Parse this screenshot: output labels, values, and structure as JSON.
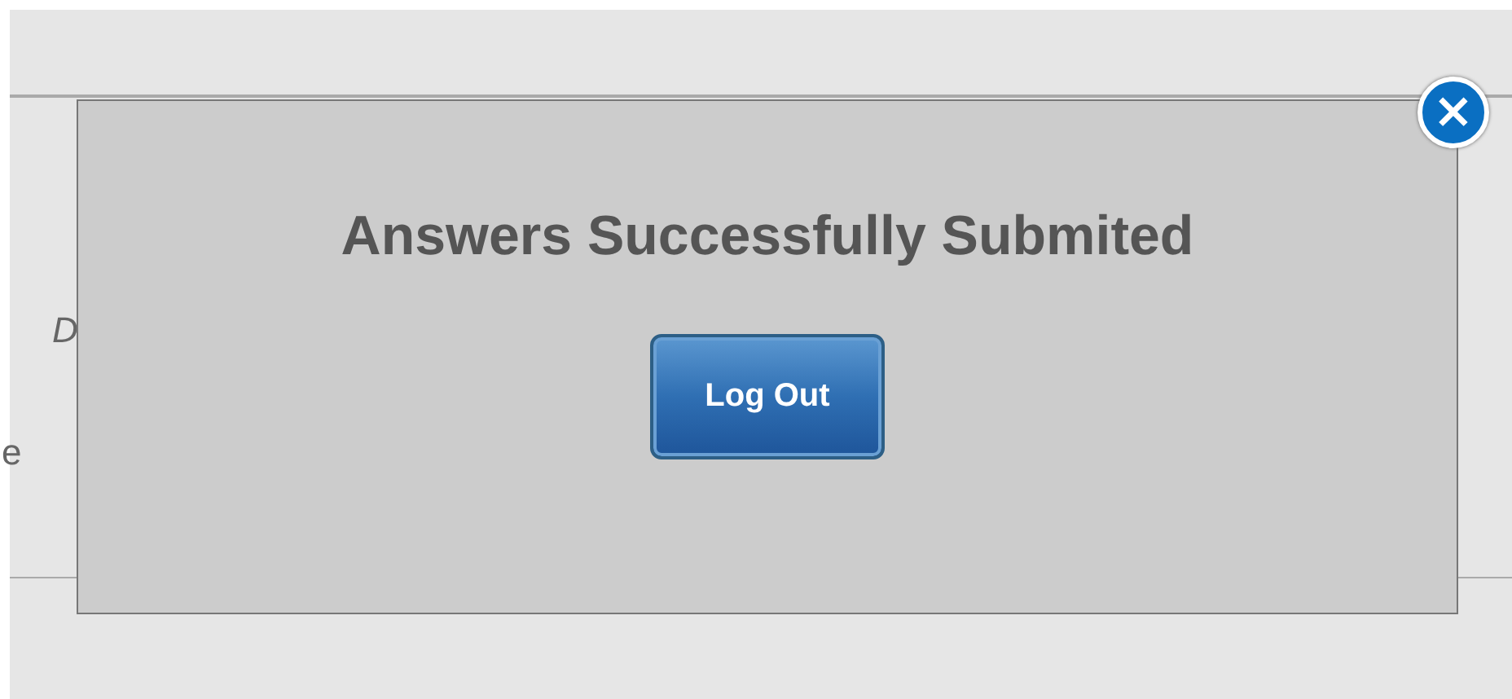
{
  "background": {
    "texts": [
      {
        "text": "D",
        "kind": "italic"
      },
      {
        "text": "e",
        "kind": "plain"
      }
    ]
  },
  "dialog": {
    "title": "Answers Successfully Submited",
    "button": "Log Out",
    "close": "×"
  }
}
